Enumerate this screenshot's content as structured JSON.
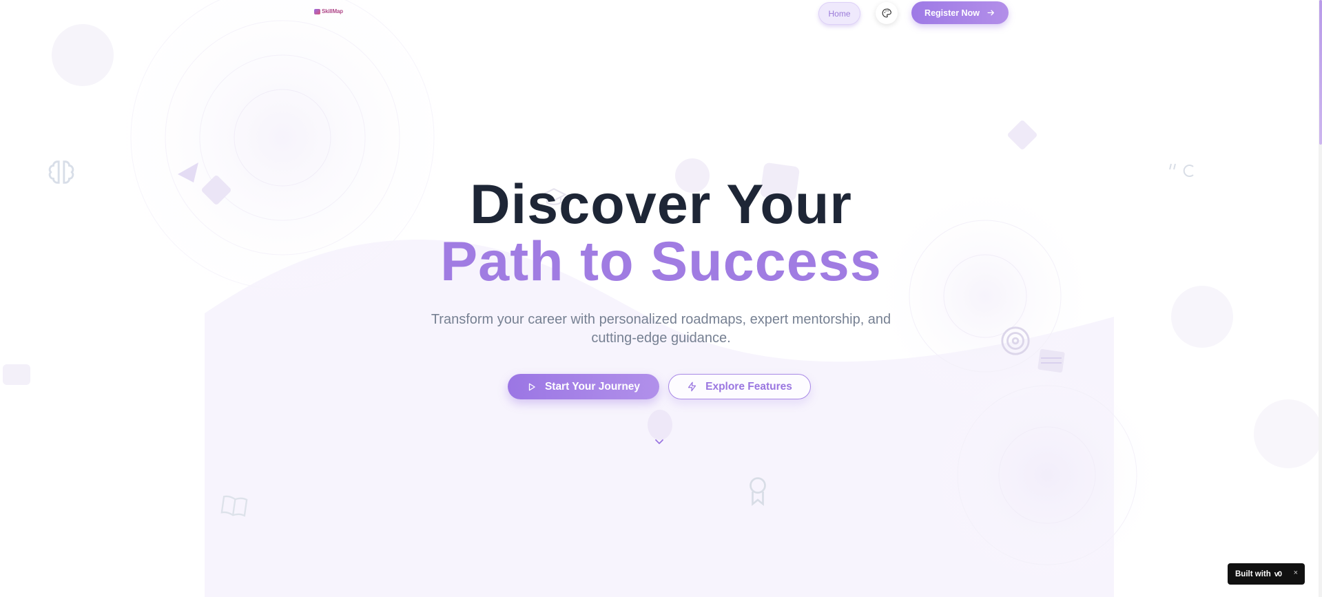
{
  "nav": {
    "logo_text": "SkillMap",
    "home_label": "Home",
    "theme_icon": "palette-icon",
    "register_label": "Register Now",
    "register_icon": "arrow-right-icon"
  },
  "hero": {
    "title_line1": "Discover Your",
    "title_line2": "Path to Success",
    "subtitle_line1": "Transform your career with personalized roadmaps, expert mentorship, and",
    "subtitle_line2": "cutting-edge guidance.",
    "primary_button": "Start Your Journey",
    "primary_icon": "play-icon",
    "secondary_button": "Explore Features",
    "secondary_icon": "zap-icon",
    "scroll_icon": "chevron-down-icon"
  },
  "badge": {
    "label": "Built with",
    "brand": "v0",
    "close": "×"
  },
  "colors": {
    "accent": "#a07ce2",
    "heading": "#1e2636",
    "subtitle": "#768092"
  }
}
